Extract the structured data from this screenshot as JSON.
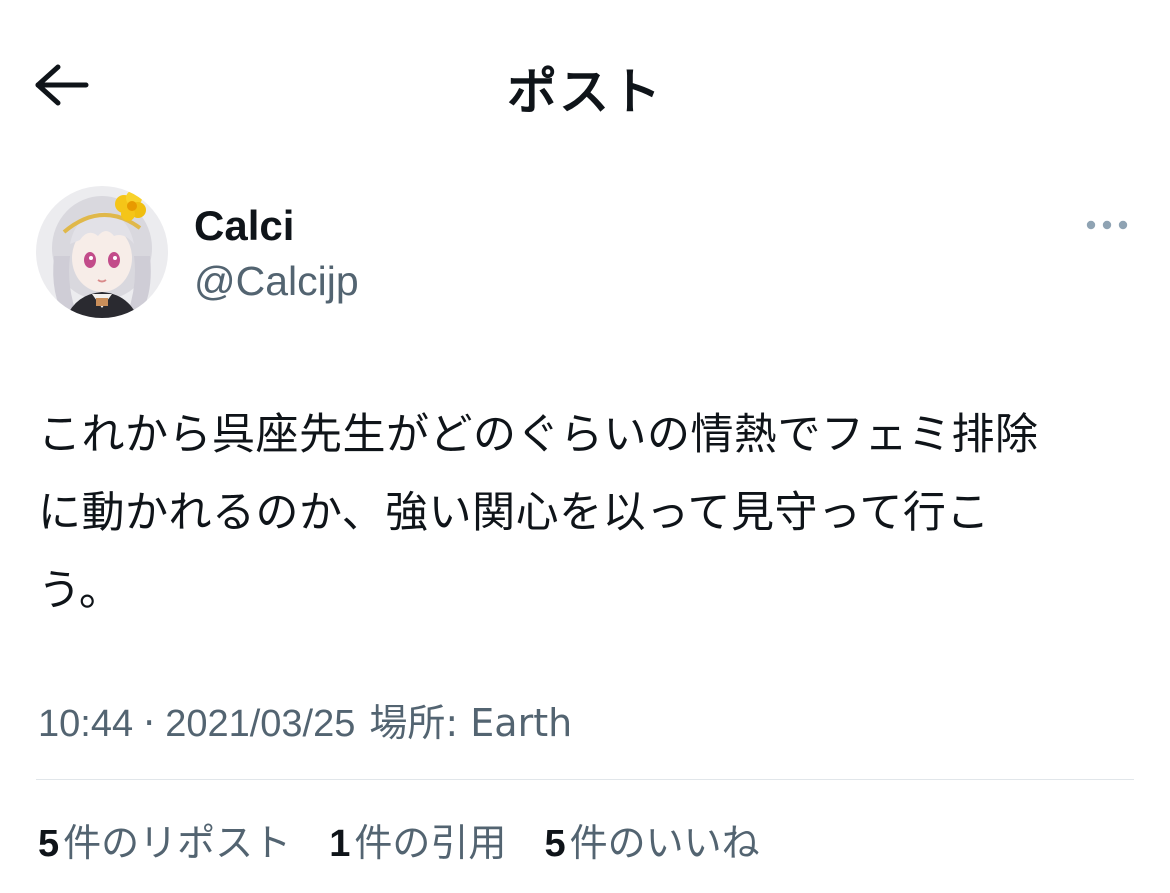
{
  "header": {
    "title": "ポスト",
    "back_icon": "arrow-left-icon"
  },
  "author": {
    "display_name": "Calci",
    "handle": "@Calcijp",
    "more_icon": "more-horizontal-icon"
  },
  "tweet": {
    "lines": [
      "これから呉座先生がどのぐらいの情熱でフェミ排除",
      "に動かれるのか、強い関心を以って見守って行こ",
      "う。"
    ]
  },
  "meta": {
    "time": "10:44",
    "separator": "·",
    "date": "2021/03/25",
    "location_label": "場所:",
    "location": "Earth"
  },
  "stats": {
    "reposts": {
      "count": "5",
      "label": "件のリポスト"
    },
    "quotes": {
      "count": "1",
      "label": "件の引用"
    },
    "likes": {
      "count": "5",
      "label": "件のいいね"
    }
  },
  "colors": {
    "text_primary": "#0f1419",
    "text_secondary": "#536471",
    "divider": "#e1e6ea",
    "more_dots": "#8fa3b3"
  }
}
